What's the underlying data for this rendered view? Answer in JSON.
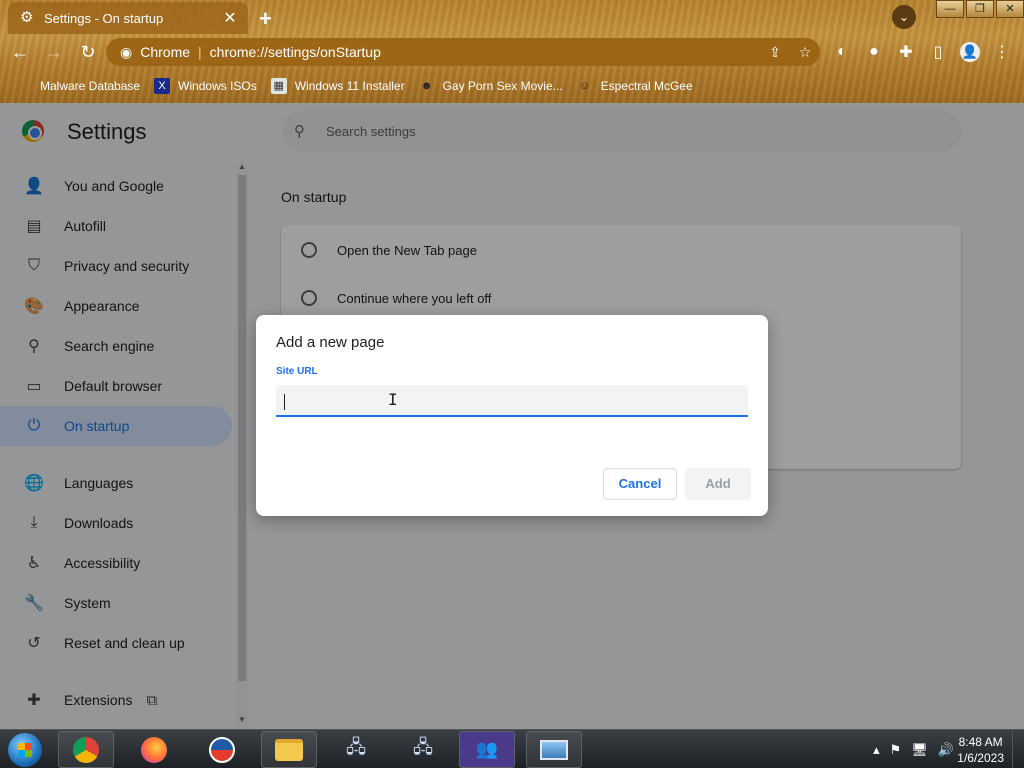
{
  "browser": {
    "tab_title": "Settings - On startup",
    "tab_close": "✕",
    "new_tab": "+",
    "omnibox_site": "Chrome",
    "omnibox_url": "chrome://settings/onStartup",
    "window_controls": [
      "—",
      "❐",
      "✕"
    ]
  },
  "bookmarks": [
    {
      "label": "Malware Database",
      "icon": "bookmark-icon"
    },
    {
      "label": "Windows ISOs",
      "icon": "x-icon"
    },
    {
      "label": "Windows 11 Installer",
      "icon": "image-icon"
    },
    {
      "label": "Gay Porn Sex Movie...",
      "icon": "site-icon"
    },
    {
      "label": "Espectral McGee",
      "icon": "avatar-icon"
    }
  ],
  "settings": {
    "title": "Settings",
    "search_placeholder": "Search settings",
    "nav": [
      {
        "label": "You and Google",
        "icon": "person-icon"
      },
      {
        "label": "Autofill",
        "icon": "clipboard-icon"
      },
      {
        "label": "Privacy and security",
        "icon": "shield-icon"
      },
      {
        "label": "Appearance",
        "icon": "palette-icon"
      },
      {
        "label": "Search engine",
        "icon": "search-icon"
      },
      {
        "label": "Default browser",
        "icon": "browser-icon"
      },
      {
        "label": "On startup",
        "icon": "power-icon",
        "active": true
      },
      {
        "label": "Languages",
        "icon": "globe-icon"
      },
      {
        "label": "Downloads",
        "icon": "download-icon"
      },
      {
        "label": "Accessibility",
        "icon": "accessibility-icon"
      },
      {
        "label": "System",
        "icon": "wrench-icon"
      },
      {
        "label": "Reset and clean up",
        "icon": "history-icon"
      },
      {
        "label": "Extensions",
        "icon": "puzzle-icon"
      }
    ],
    "section_title": "On startup",
    "options": [
      "Open the New Tab page",
      "Continue where you left off"
    ]
  },
  "dialog": {
    "title": "Add a new page",
    "field_label": "Site URL",
    "input_value": "",
    "cancel_label": "Cancel",
    "add_label": "Add"
  },
  "taskbar": {
    "time": "8:48 AM",
    "date": "1/6/2023"
  },
  "colors": {
    "accent": "#1a73e8",
    "active_nav_bg": "#d2e3fc",
    "theme_wood": "#b7832f"
  }
}
